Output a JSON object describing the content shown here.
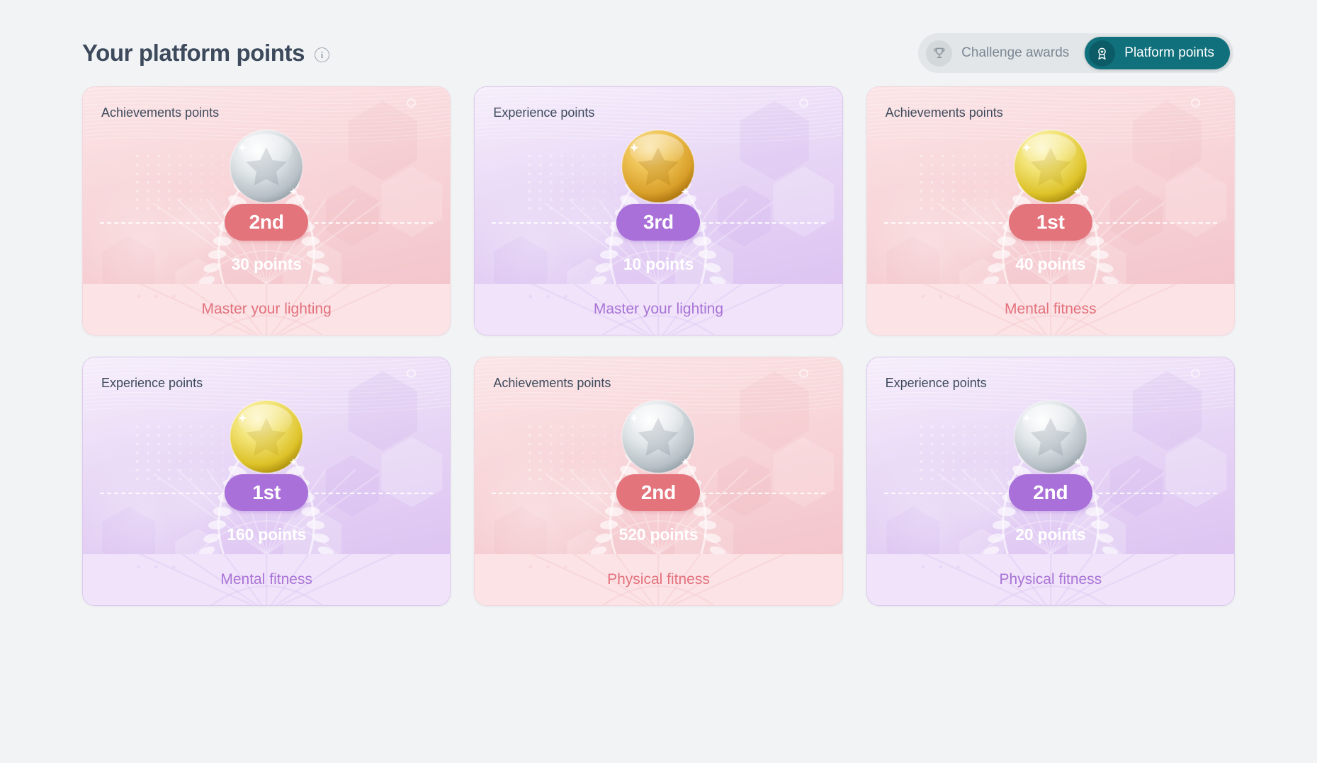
{
  "header": {
    "title": "Your platform points",
    "info_icon": "info-icon"
  },
  "toggle": {
    "options": [
      {
        "label": "Challenge awards",
        "icon": "trophy-icon",
        "active": false
      },
      {
        "label": "Platform points",
        "icon": "award-medal-icon",
        "active": true
      }
    ],
    "focus_ring_color": "#23c2c9",
    "active_bg": "#10717c",
    "inactive_track": "#e2e6e8"
  },
  "colors": {
    "page_bg": "#f1f3f5",
    "title": "#3d4a5c",
    "pink_badge": "#e3747c",
    "purple_badge": "#a970d9",
    "pink_footer_text": "#e3717c",
    "purple_footer_text": "#a974d6"
  },
  "cards": [
    {
      "title": "Achievements points",
      "rank": "2nd",
      "points": "30 points",
      "challenge": "Master your lighting",
      "theme": "pink",
      "medal": "silver-medal-icon"
    },
    {
      "title": "Experience points",
      "rank": "3rd",
      "points": "10 points",
      "challenge": "Master your lighting",
      "theme": "purple",
      "medal": "bronze-medal-icon"
    },
    {
      "title": "Achievements points",
      "rank": "1st",
      "points": "40 points",
      "challenge": "Mental fitness",
      "theme": "pink",
      "medal": "gold-medal-icon"
    },
    {
      "title": "Experience points",
      "rank": "1st",
      "points": "160 points",
      "challenge": "Mental fitness",
      "theme": "purple",
      "medal": "gold-medal-icon"
    },
    {
      "title": "Achievements points",
      "rank": "2nd",
      "points": "520 points",
      "challenge": "Physical fitness",
      "theme": "pink",
      "medal": "silver-medal-icon"
    },
    {
      "title": "Experience points",
      "rank": "2nd",
      "points": "20 points",
      "challenge": "Physical fitness",
      "theme": "purple",
      "medal": "silver-medal-icon"
    }
  ]
}
